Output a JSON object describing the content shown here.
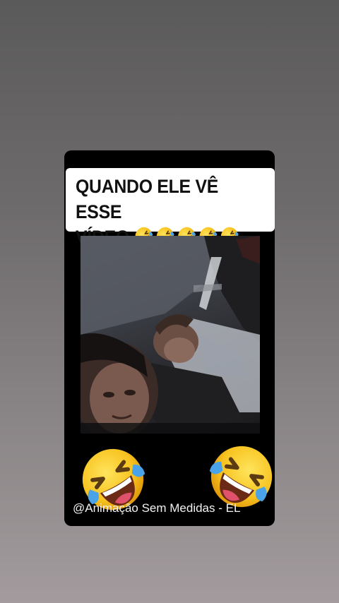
{
  "caption": {
    "text": "QUANDO ELE VÊ ESSE\nVÍDEO",
    "emoji_count": 5,
    "emoji_icon": "rolling-on-floor-laughing-icon"
  },
  "video": {
    "description_icon": "video-frame"
  },
  "reactions": {
    "left_icon": "rolling-on-floor-laughing-icon",
    "right_icon": "rolling-on-floor-laughing-icon"
  },
  "watermark": {
    "text": "@Animação Sem Medidas - EL"
  },
  "colors": {
    "background_top": "#5b5a5a",
    "background_bottom": "#a39b9d",
    "card": "#000000",
    "caption_bg": "#ffffff",
    "emoji_yellow": "#f7c21e",
    "tear_blue": "#4aa3e8"
  }
}
